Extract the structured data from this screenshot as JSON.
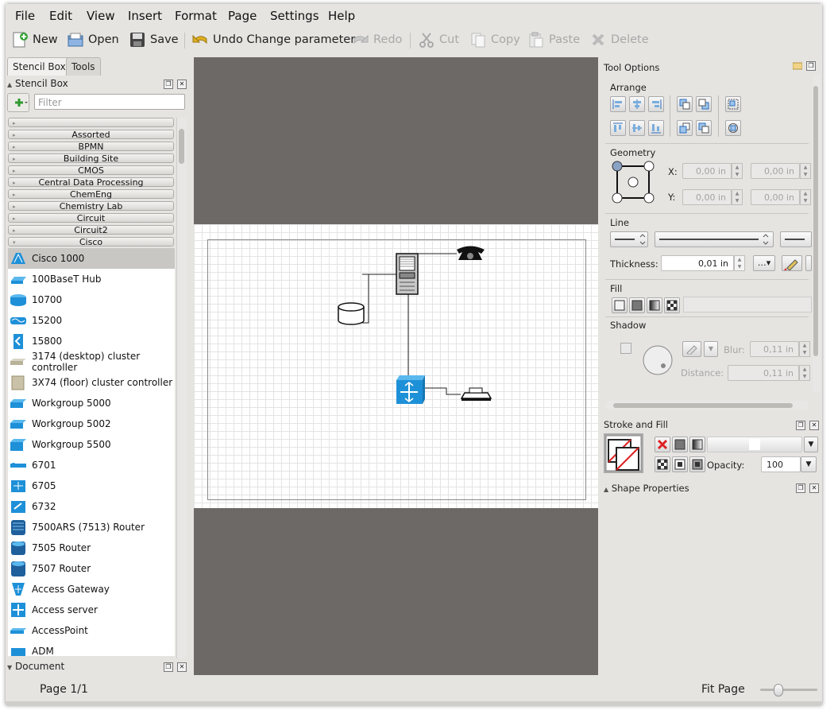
{
  "menubar": {
    "items": [
      "File",
      "Edit",
      "View",
      "Insert",
      "Format",
      "Page",
      "Settings",
      "Help"
    ]
  },
  "toolbar": {
    "new": "New",
    "open": "Open",
    "save": "Save",
    "undo": "Undo Change parameter",
    "redo": "Redo",
    "cut": "Cut",
    "copy": "Copy",
    "paste": "Paste",
    "delete": "Delete"
  },
  "left_dock": {
    "tabs": [
      "Stencil Box",
      "Tools"
    ],
    "stencil_title": "Stencil Box",
    "filter_placeholder": "Filter",
    "categories": [
      "",
      "Assorted",
      "BPMN",
      "Building Site",
      "CMOS",
      "Central Data Processing",
      "ChemEng",
      "Chemistry Lab",
      "Circuit",
      "Circuit2",
      "Cisco"
    ],
    "shapes": [
      "Cisco 1000",
      "100BaseT Hub",
      "10700",
      "15200",
      "15800",
      "3174 (desktop) cluster controller",
      "3X74 (floor) cluster controller",
      "Workgroup 5000",
      "Workgroup 5002",
      "Workgroup 5500",
      "6701",
      "6705",
      "6732",
      "7500ARS (7513) Router",
      "7505 Router",
      "7507 Router",
      "Access Gateway",
      "Access server",
      "AccessPoint",
      "ADM"
    ],
    "selected_shape": "Cisco 1000",
    "document_title": "Document"
  },
  "tool_options": {
    "title": "Tool Options",
    "arrange_label": "Arrange",
    "geometry_label": "Geometry",
    "x_label": "X:",
    "y_label": "Y:",
    "x_value": "0,00 in",
    "x_value2": "0,00 in",
    "y_value": "0,00 in",
    "y_value2": "0,00 in",
    "line_label": "Line",
    "thickness_label": "Thickness:",
    "thickness_value": "0,01 in",
    "fill_label": "Fill",
    "shadow_label": "Shadow",
    "blur_label": "Blur:",
    "blur_value": "0,11 in",
    "distance_label": "Distance:",
    "distance_value": "0,11 in"
  },
  "stroke_fill": {
    "title": "Stroke and Fill",
    "opacity_label": "Opacity:",
    "opacity_value": "100"
  },
  "shape_properties": {
    "title": "Shape Properties"
  },
  "status": {
    "page": "Page 1/1",
    "zoom": "Fit Page",
    "zoom_level": 0.3
  },
  "colors": {
    "accent_cisco": "#1e90d8",
    "canvas_bg": "#6d6966",
    "window_bg": "#e6e4e1"
  }
}
